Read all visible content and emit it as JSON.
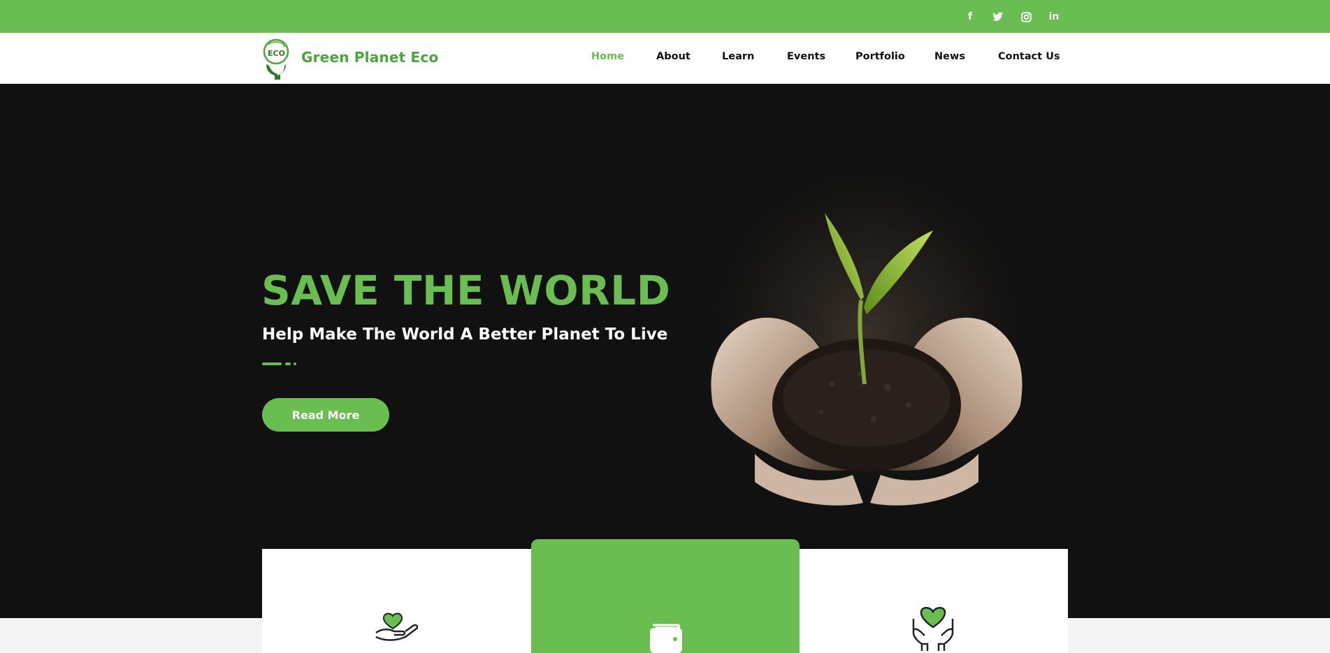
{
  "colors": {
    "accent": "#6abd51",
    "brand_text": "#4ca53b",
    "hero_bg": "#111111",
    "nav_text": "#111111"
  },
  "social": [
    {
      "name": "facebook-icon",
      "glyph": "f"
    },
    {
      "name": "twitter-icon",
      "glyph": "t"
    },
    {
      "name": "instagram-icon",
      "glyph": "◎"
    },
    {
      "name": "linkedin-icon",
      "glyph": "in"
    }
  ],
  "brand": {
    "logo_text": "ECO",
    "name": "Green Planet Eco"
  },
  "nav": [
    "Home",
    "About",
    "Learn",
    "Events",
    "Portfolio",
    "News",
    "Contact Us"
  ],
  "nav_active": "Home",
  "hero": {
    "title": "SAVE THE WORLD",
    "subtitle": "Help Make The World A Better Planet To Live",
    "cta": "Read More"
  },
  "features": [
    {
      "icon": "heart-in-hand-icon"
    },
    {
      "icon": "wallet-icon"
    },
    {
      "icon": "heart-hands-icon"
    }
  ]
}
